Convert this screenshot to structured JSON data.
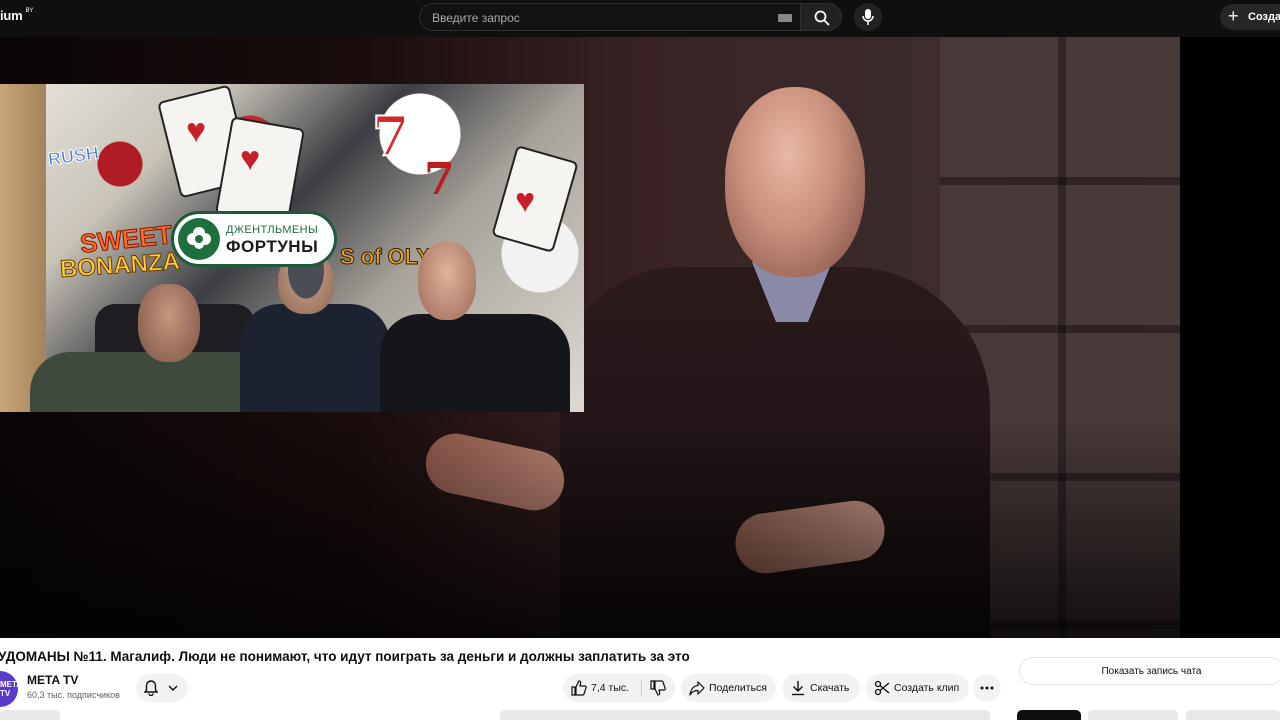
{
  "header": {
    "logo_text": "ium",
    "logo_sup": "BY",
    "search_placeholder": "Введите запрос",
    "create_label": "Создать"
  },
  "video": {
    "inset_badge_line1": "ДЖЕНТЛЬМЕНЫ",
    "inset_badge_line2": "ФОРТУНЫ",
    "inset_art_sweet": "SWEET",
    "inset_art_bonanza": "BONANZA",
    "inset_art_olymp": "S of OLYM",
    "inset_art_rush": "RUSH",
    "inset_art_seven": "7"
  },
  "info": {
    "title": "УДОМАНЫ №11. Магалиф. Люди не понимают, что идут поиграть за деньги и должны заплатить за это",
    "channel_avatar": "META\nTV",
    "channel_name": "META TV",
    "subscribers": "60,3 тыс. подписчиков",
    "like_count": "7,4 тыс.",
    "share_label": "Поделиться",
    "download_label": "Скачать",
    "clip_label": "Создать клип",
    "chat_replay_label": "Показать запись чата"
  },
  "colors": {
    "topbar_bg": "#0f0f0f",
    "page_bg": "#ffffff",
    "pill_bg": "#f2f2f2",
    "avatar_bg": "#5a3ac8",
    "badge_green": "#1f6e3e"
  }
}
